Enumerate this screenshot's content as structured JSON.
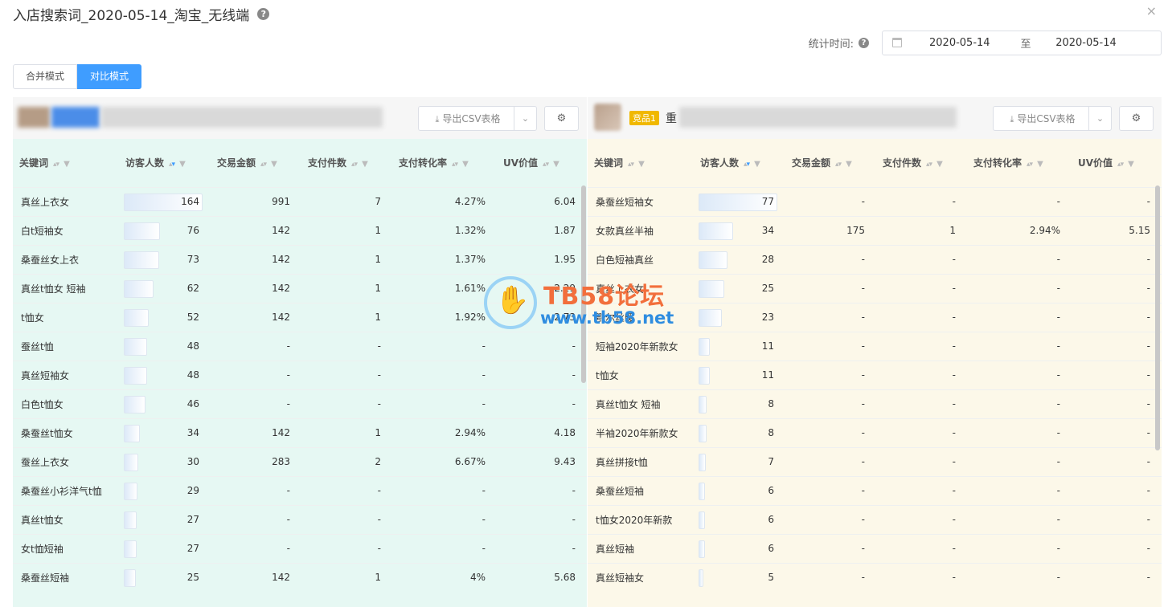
{
  "header": {
    "title": "入店搜索词_2020-05-14_淘宝_无线端",
    "help_icon": "?",
    "close_icon": "×"
  },
  "stat": {
    "label": "统计时间:",
    "start": "2020-05-14",
    "sep": "至",
    "end": "2020-05-14"
  },
  "modes": [
    "合并模式",
    "对比模式"
  ],
  "panels": {
    "left": {
      "export_label": "导出CSV表格",
      "gear": "⚙"
    },
    "right": {
      "badge": "竞品1",
      "shop_char": "重",
      "export_label": "导出CSV表格",
      "gear": "⚙"
    }
  },
  "columns": [
    "关键词",
    "访客人数",
    "交易金额",
    "支付件数",
    "支付转化率",
    "UV价值"
  ],
  "left_rows": [
    [
      "真丝上衣女",
      "164",
      "991",
      "7",
      "4.27%",
      "6.04"
    ],
    [
      "白t短袖女",
      "76",
      "142",
      "1",
      "1.32%",
      "1.87"
    ],
    [
      "桑蚕丝女上衣",
      "73",
      "142",
      "1",
      "1.37%",
      "1.95"
    ],
    [
      "真丝t恤女 短袖",
      "62",
      "142",
      "1",
      "1.61%",
      "2.29"
    ],
    [
      "t恤女",
      "52",
      "142",
      "1",
      "1.92%",
      "2.73"
    ],
    [
      "蚕丝t恤",
      "48",
      "-",
      "-",
      "-",
      "-"
    ],
    [
      "真丝短袖女",
      "48",
      "-",
      "-",
      "-",
      "-"
    ],
    [
      "白色t恤女",
      "46",
      "-",
      "-",
      "-",
      "-"
    ],
    [
      "桑蚕丝t恤女",
      "34",
      "142",
      "1",
      "2.94%",
      "4.18"
    ],
    [
      "蚕丝上衣女",
      "30",
      "283",
      "2",
      "6.67%",
      "9.43"
    ],
    [
      "桑蚕丝小衫洋气t恤",
      "29",
      "-",
      "-",
      "-",
      "-"
    ],
    [
      "真丝t恤女",
      "27",
      "-",
      "-",
      "-",
      "-"
    ],
    [
      "女t恤短袖",
      "27",
      "-",
      "-",
      "-",
      "-"
    ],
    [
      "桑蚕丝短袖",
      "25",
      "142",
      "1",
      "4%",
      "5.68"
    ]
  ],
  "right_rows": [
    [
      "桑蚕丝短袖女",
      "77",
      "-",
      "-",
      "-",
      "-"
    ],
    [
      "女款真丝半袖",
      "34",
      "175",
      "1",
      "2.94%",
      "5.15"
    ],
    [
      "白色短袖真丝",
      "28",
      "-",
      "-",
      "-",
      "-"
    ],
    [
      "真丝上衣女",
      "25",
      "-",
      "-",
      "-",
      "-"
    ],
    [
      "鄂尔丝暖",
      "23",
      "-",
      "-",
      "-",
      "-"
    ],
    [
      "短袖2020年新款女",
      "11",
      "-",
      "-",
      "-",
      "-"
    ],
    [
      "t恤女",
      "11",
      "-",
      "-",
      "-",
      "-"
    ],
    [
      "真丝t恤女 短袖",
      "8",
      "-",
      "-",
      "-",
      "-"
    ],
    [
      "半袖2020年新款女",
      "8",
      "-",
      "-",
      "-",
      "-"
    ],
    [
      "真丝拼接t恤",
      "7",
      "-",
      "-",
      "-",
      "-"
    ],
    [
      "桑蚕丝短袖",
      "6",
      "-",
      "-",
      "-",
      "-"
    ],
    [
      "t恤女2020年新款",
      "6",
      "-",
      "-",
      "-",
      "-"
    ],
    [
      "真丝短袖",
      "6",
      "-",
      "-",
      "-",
      "-"
    ],
    [
      "真丝短袖女",
      "5",
      "-",
      "-",
      "-",
      "-"
    ]
  ],
  "left_visitor_max": 164,
  "right_visitor_max": 77,
  "watermark": {
    "title": "TB58论坛",
    "url": "www.tb58.net"
  }
}
